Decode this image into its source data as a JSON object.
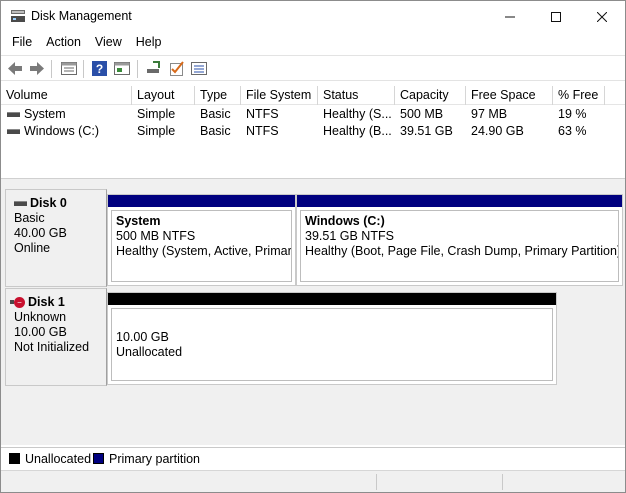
{
  "window": {
    "title": "Disk Management"
  },
  "menu": [
    "File",
    "Action",
    "View",
    "Help"
  ],
  "toolbar": {
    "icons": [
      "back-arrow-icon",
      "forward-arrow-icon",
      "properties-icon",
      "help-icon",
      "show-hide-icon",
      "connect-icon",
      "check-icon",
      "settings-list-icon"
    ]
  },
  "volume_list": {
    "columns": [
      "Volume",
      "Layout",
      "Type",
      "File System",
      "Status",
      "Capacity",
      "Free Space",
      "% Free"
    ],
    "rows": [
      [
        "System",
        "Simple",
        "Basic",
        "NTFS",
        "Healthy (S...",
        "500 MB",
        "97 MB",
        "19 %"
      ],
      [
        "Windows (C:)",
        "Simple",
        "Basic",
        "NTFS",
        "Healthy (B...",
        "39.51 GB",
        "24.90 GB",
        "63 %"
      ]
    ]
  },
  "disks": [
    {
      "name": "Disk 0",
      "type": "Basic",
      "size": "40.00 GB",
      "state": "Online",
      "partitions": [
        {
          "name": "System",
          "size_fs": "500 MB NTFS",
          "status": "Healthy (System, Active, Primary",
          "bar_color": "#00007f"
        },
        {
          "name": "Windows  (C:)",
          "size_fs": "39.51 GB NTFS",
          "status": "Healthy (Boot, Page File, Crash Dump, Primary Partition)",
          "bar_color": "#00007f"
        }
      ]
    },
    {
      "name": "Disk 1",
      "type": "Unknown",
      "size": "10.00 GB",
      "state": "Not Initialized",
      "partitions": [
        {
          "size": "10.00 GB",
          "label": "Unallocated",
          "bar_color": "#000000"
        }
      ]
    }
  ],
  "legend": [
    {
      "label": "Unallocated",
      "color": "#000000"
    },
    {
      "label": "Primary partition",
      "color": "#00007f"
    }
  ]
}
